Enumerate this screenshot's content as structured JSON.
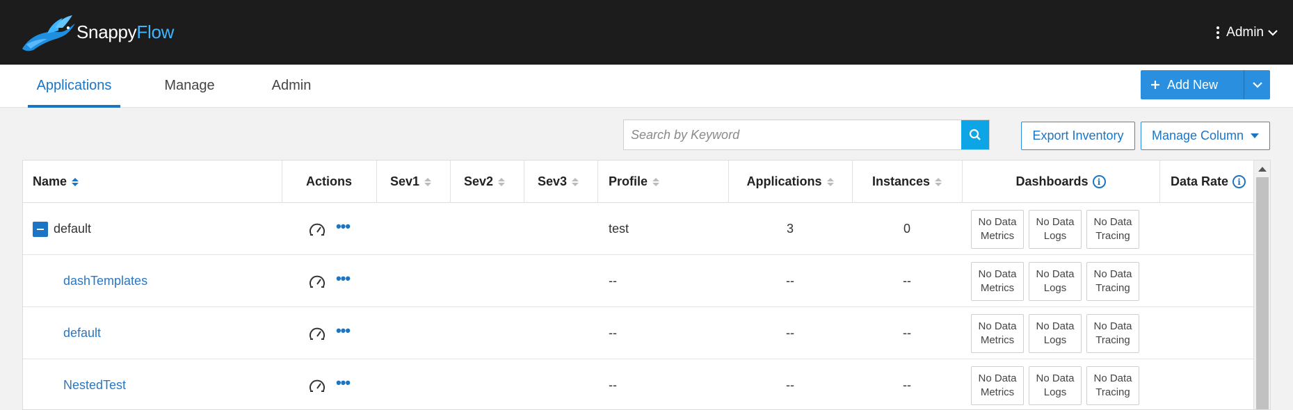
{
  "header": {
    "logo_text": "Snappy",
    "logo_text_flow": "Flow",
    "user_menu_label": "Admin"
  },
  "nav": {
    "tabs": [
      {
        "label": "Applications",
        "active": true
      },
      {
        "label": "Manage",
        "active": false
      },
      {
        "label": "Admin",
        "active": false
      }
    ],
    "add_new_label": "Add New"
  },
  "toolbar": {
    "search_placeholder": "Search by Keyword",
    "export_label": "Export Inventory",
    "manage_column_label": "Manage Column"
  },
  "table": {
    "columns": [
      "Name",
      "Actions",
      "Sev1",
      "Sev2",
      "Sev3",
      "Profile",
      "Applications",
      "Instances",
      "Dashboards",
      "Data Rate"
    ],
    "dashboard_buttons": [
      {
        "line1": "No Data",
        "line2": "Metrics"
      },
      {
        "line1": "No Data",
        "line2": "Logs"
      },
      {
        "line1": "No Data",
        "line2": "Tracing"
      }
    ],
    "rows": [
      {
        "name": "default",
        "profile": "test",
        "applications": "3",
        "instances": "0",
        "is_group": true
      },
      {
        "name": "dashTemplates",
        "profile": "--",
        "applications": "--",
        "instances": "--",
        "is_group": false
      },
      {
        "name": "default",
        "profile": "--",
        "applications": "--",
        "instances": "--",
        "is_group": false
      },
      {
        "name": "NestedTest",
        "profile": "--",
        "applications": "--",
        "instances": "--",
        "is_group": false
      }
    ]
  },
  "colors": {
    "topbar": "#1c1c1c",
    "accent": "#1b75c4",
    "primary_button": "#2b8fe0",
    "search_button": "#0ea5e6"
  }
}
